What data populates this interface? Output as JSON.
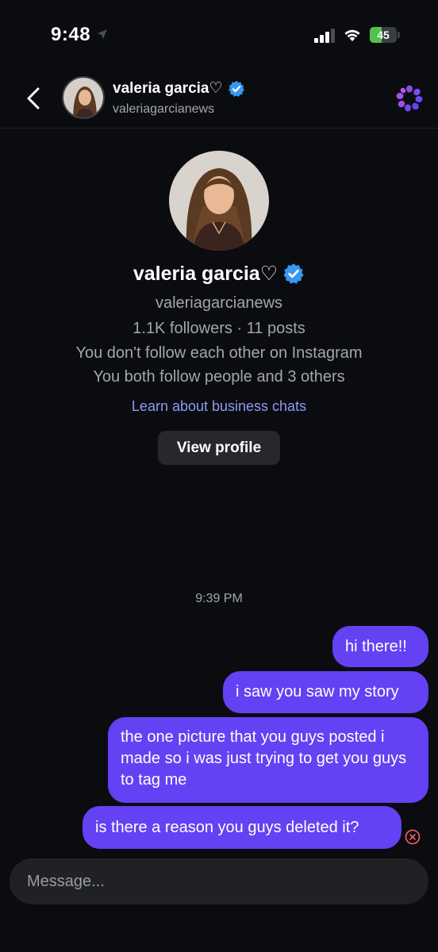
{
  "status_bar": {
    "time": "9:48",
    "battery": {
      "level": 45,
      "label": "45",
      "charging": true,
      "color": "#52c24a"
    }
  },
  "header": {
    "name": "valeria garcia♡",
    "username": "valeriagarcianews"
  },
  "profile": {
    "name": "valeria garcia♡",
    "username": "valeriagarcianews",
    "stats": "1.1K followers · 11 posts",
    "follow_status": "You don't follow each other on Instagram",
    "mutual": "You both follow people and 3 others",
    "learn_link": "Learn about business chats",
    "view_profile_label": "View profile"
  },
  "conversation": {
    "timestamp": "9:39 PM",
    "messages": [
      {
        "text": "hi there!!",
        "sender": "me"
      },
      {
        "text": "i saw you saw my story",
        "sender": "me"
      },
      {
        "text": "the one picture that you guys posted i made so i was just trying to get you guys to tag me",
        "sender": "me"
      },
      {
        "text": "is there a reason you guys deleted it?",
        "sender": "me",
        "status": "failed"
      }
    ]
  },
  "composer": {
    "placeholder": "Message..."
  },
  "icons": {
    "back": "chevron-left-icon",
    "verified": "verified-badge-icon",
    "ai": "meta-ai-icon",
    "failed": "send-failed-icon",
    "location": "location-arrow-icon",
    "signal": "cellular-signal-icon",
    "wifi": "wifi-icon"
  },
  "colors": {
    "background": "#0b0c10",
    "bubble": "#6441f3",
    "verified": "#3897f0",
    "link": "#8e9af3",
    "failed": "#ff5c6c"
  }
}
